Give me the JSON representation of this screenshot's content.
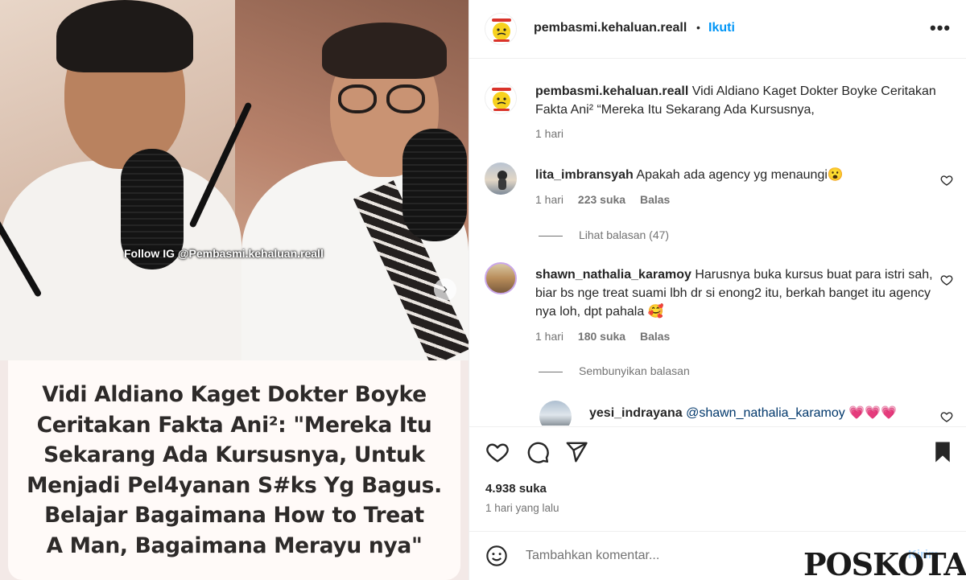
{
  "media": {
    "watermark": "Follow IG @Pembasmi.kehaluan.reall",
    "caption_lines": [
      "Vidi Aldiano Kaget Dokter Boyke",
      "Ceritakan Fakta Ani²: \"Mereka Itu",
      "Sekarang Ada Kursusnya, Untuk",
      "Menjadi Pel4yanan S#ks Yg Bagus.",
      "Belajar Bagaimana How to Treat",
      "A Man, Bagaimana Merayu nya\""
    ]
  },
  "header": {
    "username": "pembasmi.kehaluan.reall",
    "dot": "•",
    "follow_label": "Ikuti",
    "more_label": "•••"
  },
  "caption": {
    "username": "pembasmi.kehaluan.reall",
    "text": "Vidi Aldiano Kaget Dokter Boyke Ceritakan Fakta Ani² “Mereka Itu Sekarang Ada Kursusnya,",
    "time": "1 hari"
  },
  "comments": [
    {
      "username": "lita_imbransyah",
      "text": "Apakah ada agency yg menaungi😮",
      "time": "1 hari",
      "likes": "223 suka",
      "reply_label": "Balas",
      "replies_toggle": "Lihat balasan (47)"
    },
    {
      "username": "shawn_nathalia_karamoy",
      "text": "Harusnya buka kursus buat para istri sah, biar bs nge treat suami lbh dr si enong2 itu, berkah banget itu agency nya loh, dpt pahala 🥰",
      "time": "1 hari",
      "likes": "180 suka",
      "reply_label": "Balas",
      "replies_toggle": "Sembunyikan balasan"
    }
  ],
  "reply": {
    "username": "yesi_indrayana",
    "mention": "@shawn_nathalia_karamoy",
    "emojis": "💗💗💗"
  },
  "footer": {
    "likes": "4.938 suka",
    "posted": "1 hari yang lalu",
    "comment_placeholder": "Tambahkan komentar...",
    "send_label": "Kirim"
  },
  "brand": "POSKOTA",
  "colors": {
    "accent": "#0095f6",
    "muted": "#737373",
    "text": "#262626"
  }
}
